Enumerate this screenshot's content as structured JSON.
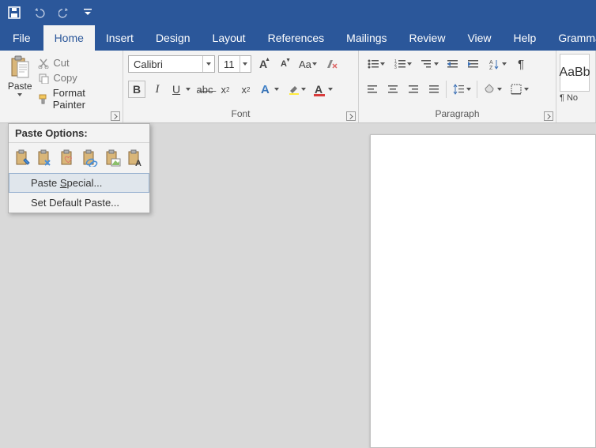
{
  "qat": {
    "save": "save-icon",
    "undo": "undo-icon",
    "redo": "redo-icon"
  },
  "tabs": {
    "file": "File",
    "items": [
      "Home",
      "Insert",
      "Design",
      "Layout",
      "References",
      "Mailings",
      "Review",
      "View",
      "Help",
      "Grammarly"
    ],
    "active_index": 0
  },
  "clipboard": {
    "paste": "Paste",
    "cut": "Cut",
    "copy": "Copy",
    "format_painter": "Format Painter"
  },
  "font": {
    "name": "Calibri",
    "size": "11",
    "group_label": "Font"
  },
  "paragraph": {
    "group_label": "Paragraph"
  },
  "styles": {
    "preview": "AaBb",
    "name": "¶ No"
  },
  "paste_menu": {
    "header": "Paste Options:",
    "special_prefix": "Paste ",
    "special_u": "S",
    "special_rest": "pecial...",
    "default": "Set Default Paste..."
  }
}
